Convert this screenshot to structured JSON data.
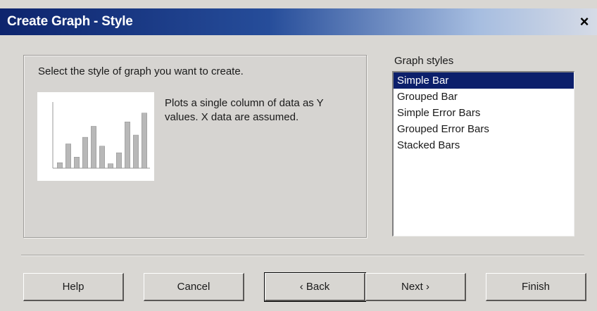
{
  "window": {
    "title": "Create Graph - Style",
    "close_glyph": "×"
  },
  "main": {
    "instruction": "Select the style of graph you want to create.",
    "description": "Plots a single column of data as Y values.  X data are assumed.",
    "preview": {
      "bar_values": [
        0.5,
        2.2,
        1.0,
        2.8,
        3.8,
        2.0,
        0.4,
        1.4,
        4.2,
        3.0,
        5.0
      ],
      "ymax": 6
    }
  },
  "styles": {
    "label": "Graph styles",
    "items": [
      {
        "label": "Simple Bar",
        "selected": true
      },
      {
        "label": "Grouped Bar",
        "selected": false
      },
      {
        "label": "Simple Error Bars",
        "selected": false
      },
      {
        "label": "Grouped Error Bars",
        "selected": false
      },
      {
        "label": "Stacked Bars",
        "selected": false
      }
    ]
  },
  "buttons": {
    "help": "Help",
    "cancel": "Cancel",
    "back": "‹ Back",
    "next": "Next ›",
    "finish": "Finish"
  },
  "colors": {
    "selection": "#0c1f6b",
    "title_gradient_start": "#0d246d",
    "preview_bar": "#b8b8b8"
  }
}
